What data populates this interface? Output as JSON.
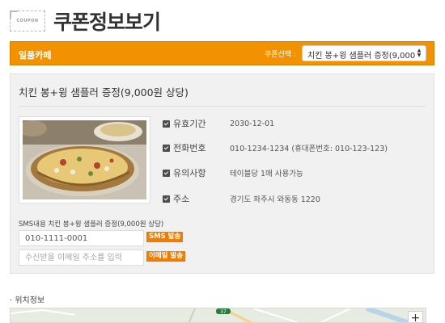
{
  "header": {
    "icon_text": "COUPON",
    "title": "쿠폰정보보기"
  },
  "store_bar": {
    "store_name": "일품카페",
    "select_label": "쿠폰선택 :",
    "selected_coupon": "치킨 봉+윙 샘플러 증정(9,000"
  },
  "coupon": {
    "name": "치킨 봉+윙 샘플러 증정(9,000원 상당)",
    "details": [
      {
        "label": "유효기간",
        "value": "2030-12-01"
      },
      {
        "label": "전화번호",
        "value": "010-1234-1234 (휴대폰번호: 010-123-123)"
      },
      {
        "label": "유의사항",
        "value": "테이블당 1매 사용가능"
      },
      {
        "label": "주소",
        "value": "경기도 파주시 와동동 1220"
      }
    ]
  },
  "sms": {
    "title": "SMS내용 치킨 봉+윙 샘플러 증정(9,000원 상당)",
    "phone_value": "010-1111-0001",
    "sms_button": "SMS 발송",
    "email_placeholder": "수신받을 이메일 주소를 입력",
    "email_button": "이메일 발송"
  },
  "location": {
    "title": "· 위치정보",
    "road_badge": "37",
    "zoom_in": "+"
  },
  "colors": {
    "accent": "#f39200",
    "button": "#f07c00",
    "panel": "#f1f1f1"
  }
}
